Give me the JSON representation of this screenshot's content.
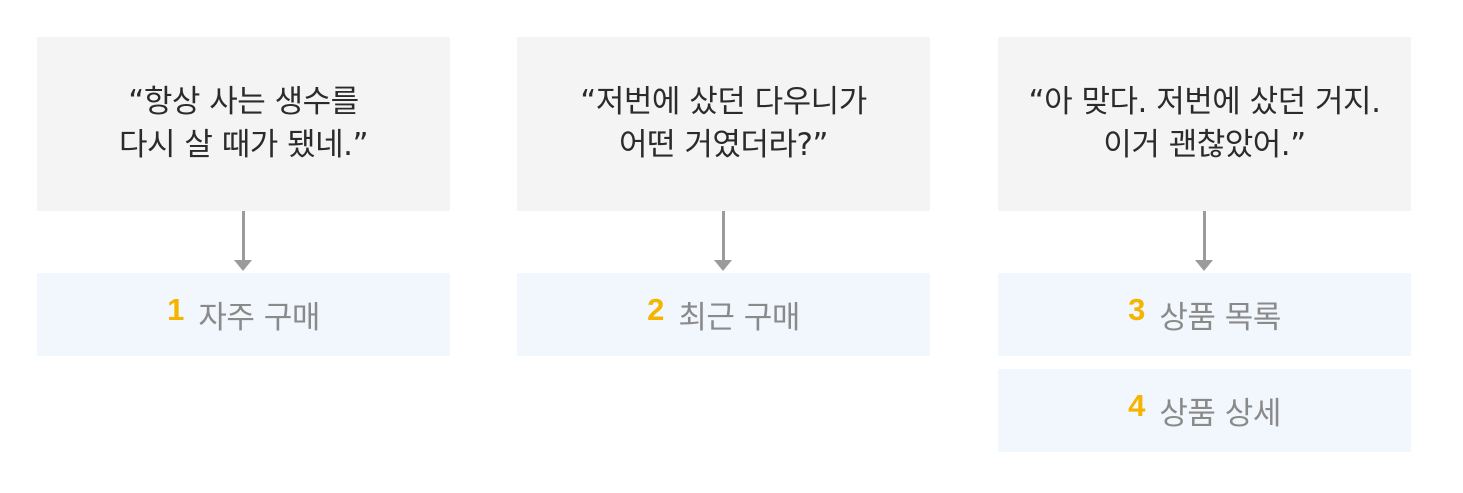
{
  "flows": [
    {
      "quote_lines": [
        "“항상 사는 생수를",
        "다시 살 때가 됐네.”"
      ],
      "screens": [
        {
          "number": "1",
          "label": "자주 구매"
        }
      ]
    },
    {
      "quote_lines": [
        "“저번에 샀던 다우니가",
        "어떤 거였더라?”"
      ],
      "screens": [
        {
          "number": "2",
          "label": "최근 구매"
        }
      ]
    },
    {
      "quote_lines": [
        "“아 맞다. 저번에 샀던 거지.",
        "이거 괜찮았어.”"
      ],
      "screens": [
        {
          "number": "3",
          "label": "상품 목록"
        },
        {
          "number": "4",
          "label": "상품 상세"
        }
      ]
    }
  ],
  "colors": {
    "quote_bg": "#f4f4f4",
    "screen_bg": "#f1f7fc",
    "number": "#f5b400",
    "label": "#8a8a8a",
    "arrow": "#9b9b9b",
    "quote_text": "#2b2b2b"
  },
  "icons": {
    "connector": "down-arrow-icon"
  }
}
